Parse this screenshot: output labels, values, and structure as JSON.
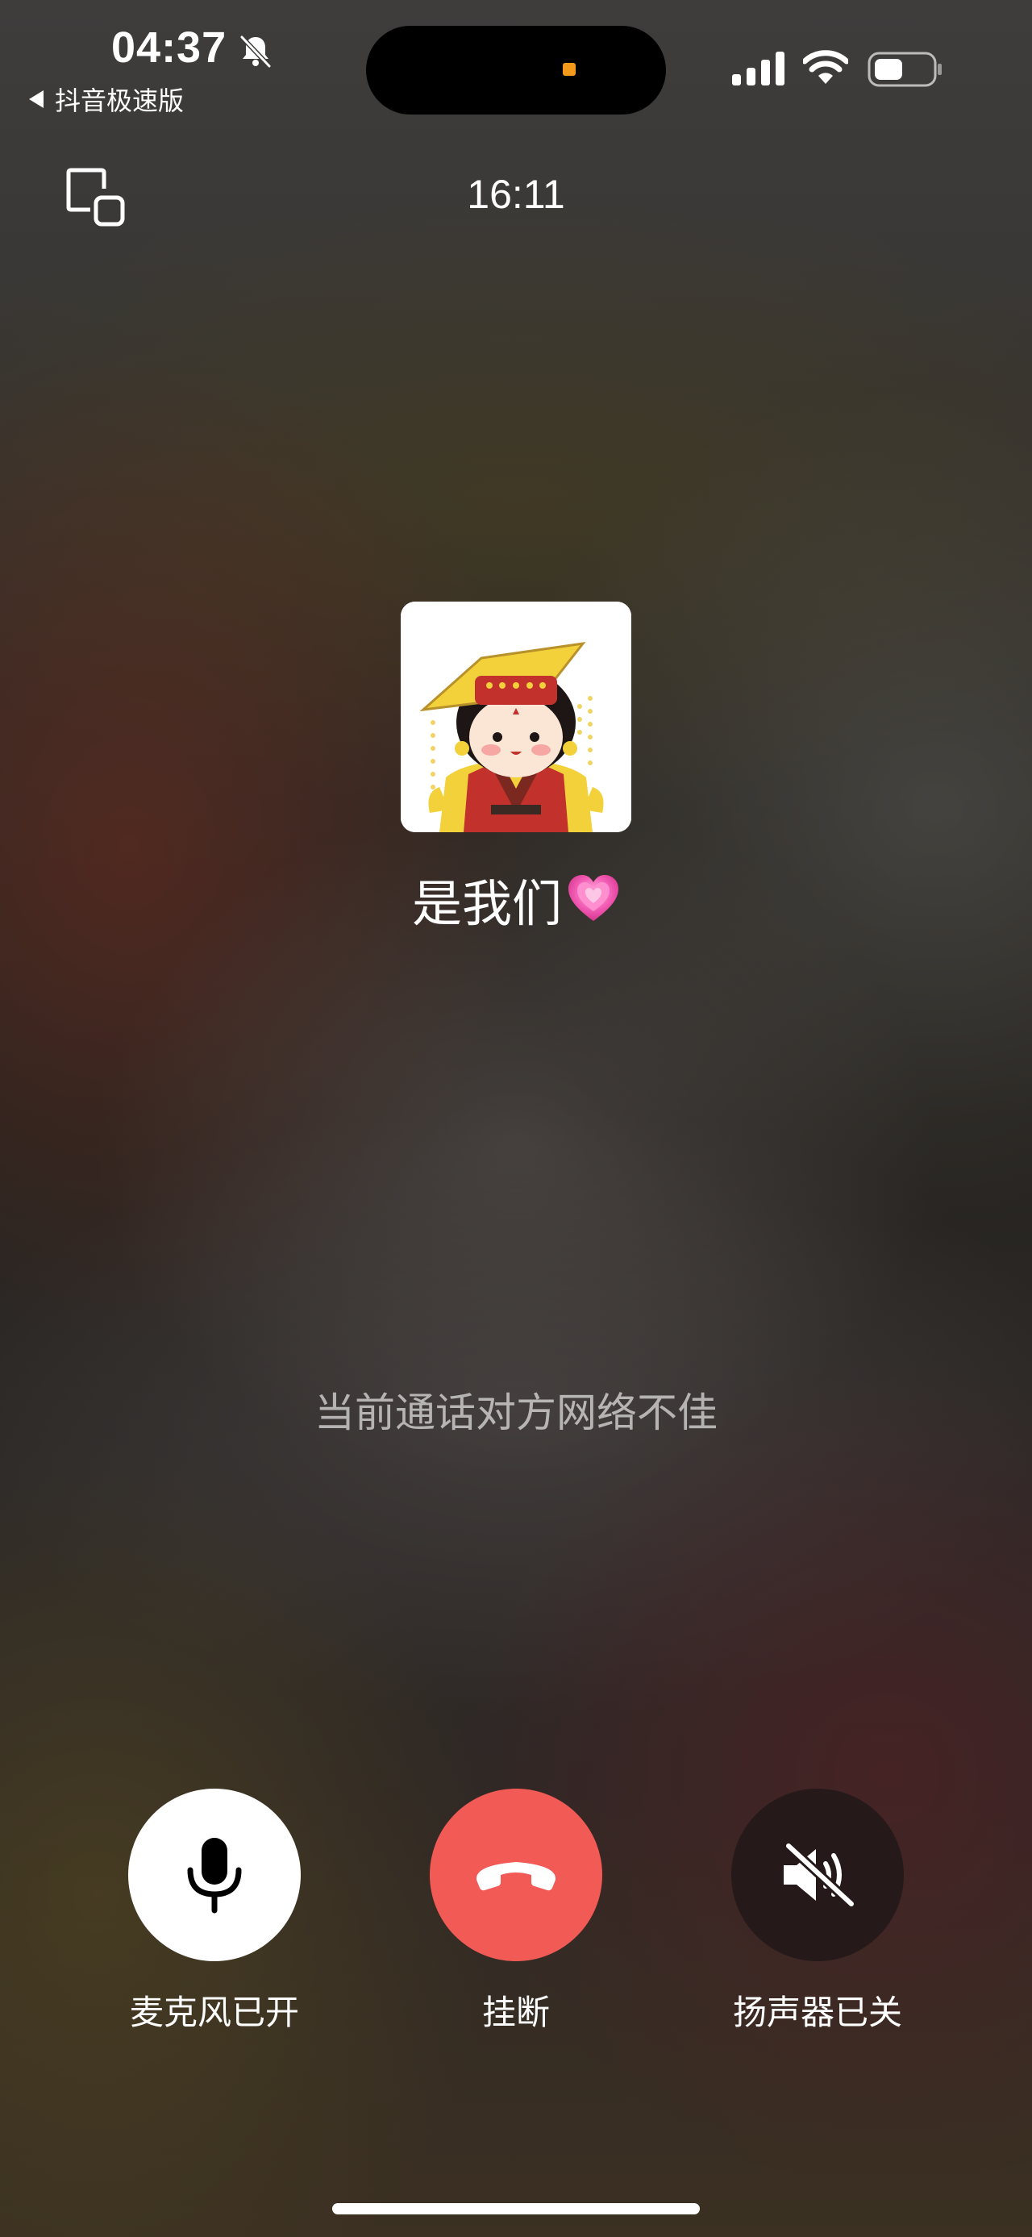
{
  "status_bar": {
    "time": "04:37",
    "back_app_label": "抖音极速版",
    "icons": [
      "bell-off-icon",
      "signal-icon",
      "wifi-icon",
      "battery-icon"
    ]
  },
  "call": {
    "duration": "16:11",
    "contact_name": "是我们",
    "contact_emoji_icon": "pink-heart-icon",
    "network_notice": "当前通话对方网络不佳"
  },
  "controls": {
    "mic": {
      "label": "麦克风已开",
      "icon": "microphone-icon"
    },
    "hangup": {
      "label": "挂断",
      "icon": "phone-hangup-icon"
    },
    "speaker": {
      "label": "扬声器已关",
      "icon": "speaker-muted-icon"
    }
  },
  "colors": {
    "hangup": "#f25a56",
    "mic_button": "#ffffff",
    "speaker_button": "#26191a",
    "island_indicator": "#f39a1c"
  }
}
